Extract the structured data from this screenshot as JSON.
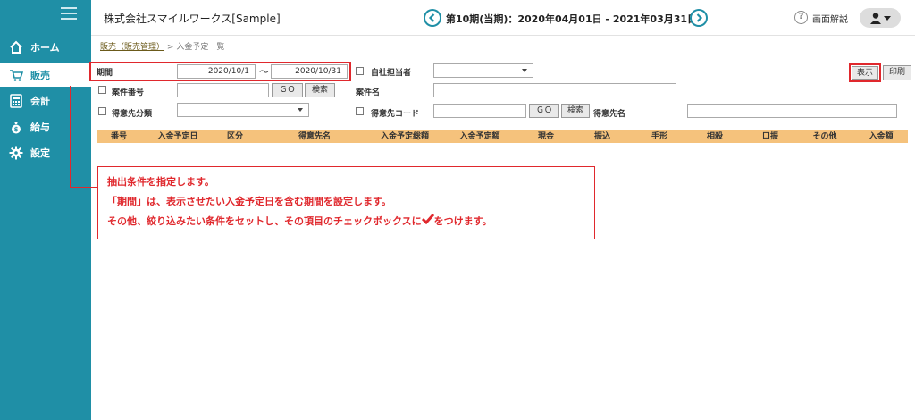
{
  "sidebar": {
    "items": [
      {
        "label": "ホーム",
        "icon": "home-icon"
      },
      {
        "label": "販売",
        "icon": "cart-icon"
      },
      {
        "label": "会計",
        "icon": "calculator-icon"
      },
      {
        "label": "給与",
        "icon": "money-bag-icon"
      },
      {
        "label": "設定",
        "icon": "gear-icon"
      }
    ],
    "active": "販売",
    "color": "#1f8fa6"
  },
  "header": {
    "company": "株式会社スマイルワークス[Sample]",
    "period": "第10期(当期)：2020年04月01日 - 2021年03月31日",
    "help_label": "画面解説"
  },
  "breadcrumb": {
    "parent": "販売（販売管理）",
    "separator": ">",
    "current": "入金予定一覧"
  },
  "form": {
    "period_label": "期間",
    "period_from": "2020/10/1",
    "period_tilde": "～",
    "period_to": "2020/10/31",
    "staff_label": "自社担当者",
    "show_button": "表示",
    "print_button": "印刷",
    "case_no_label": "案件番号",
    "go_label": "ＧＯ",
    "search_label": "検索",
    "case_name_label": "案件名",
    "client_class_label": "得意先分類",
    "client_code_label": "得意先コード",
    "client_name_label": "得意先名"
  },
  "table": {
    "columns": [
      "番号",
      "入金予定日",
      "区分",
      "得意先名",
      "入金予定総額",
      "入金予定額",
      "現金",
      "振込",
      "手形",
      "相殺",
      "口振",
      "その他",
      "入金額"
    ],
    "header_color": "#f5c27c"
  },
  "callout": {
    "line1": "抽出条件を指定します。",
    "line2": "「期間」は、表示させたい入金予定日を含む期間を設定します。",
    "line3_before": "その他、絞り込みたい条件をセットし、その項目のチェックボックスに",
    "line3_after": "をつけます。",
    "color": "#e0282d"
  }
}
